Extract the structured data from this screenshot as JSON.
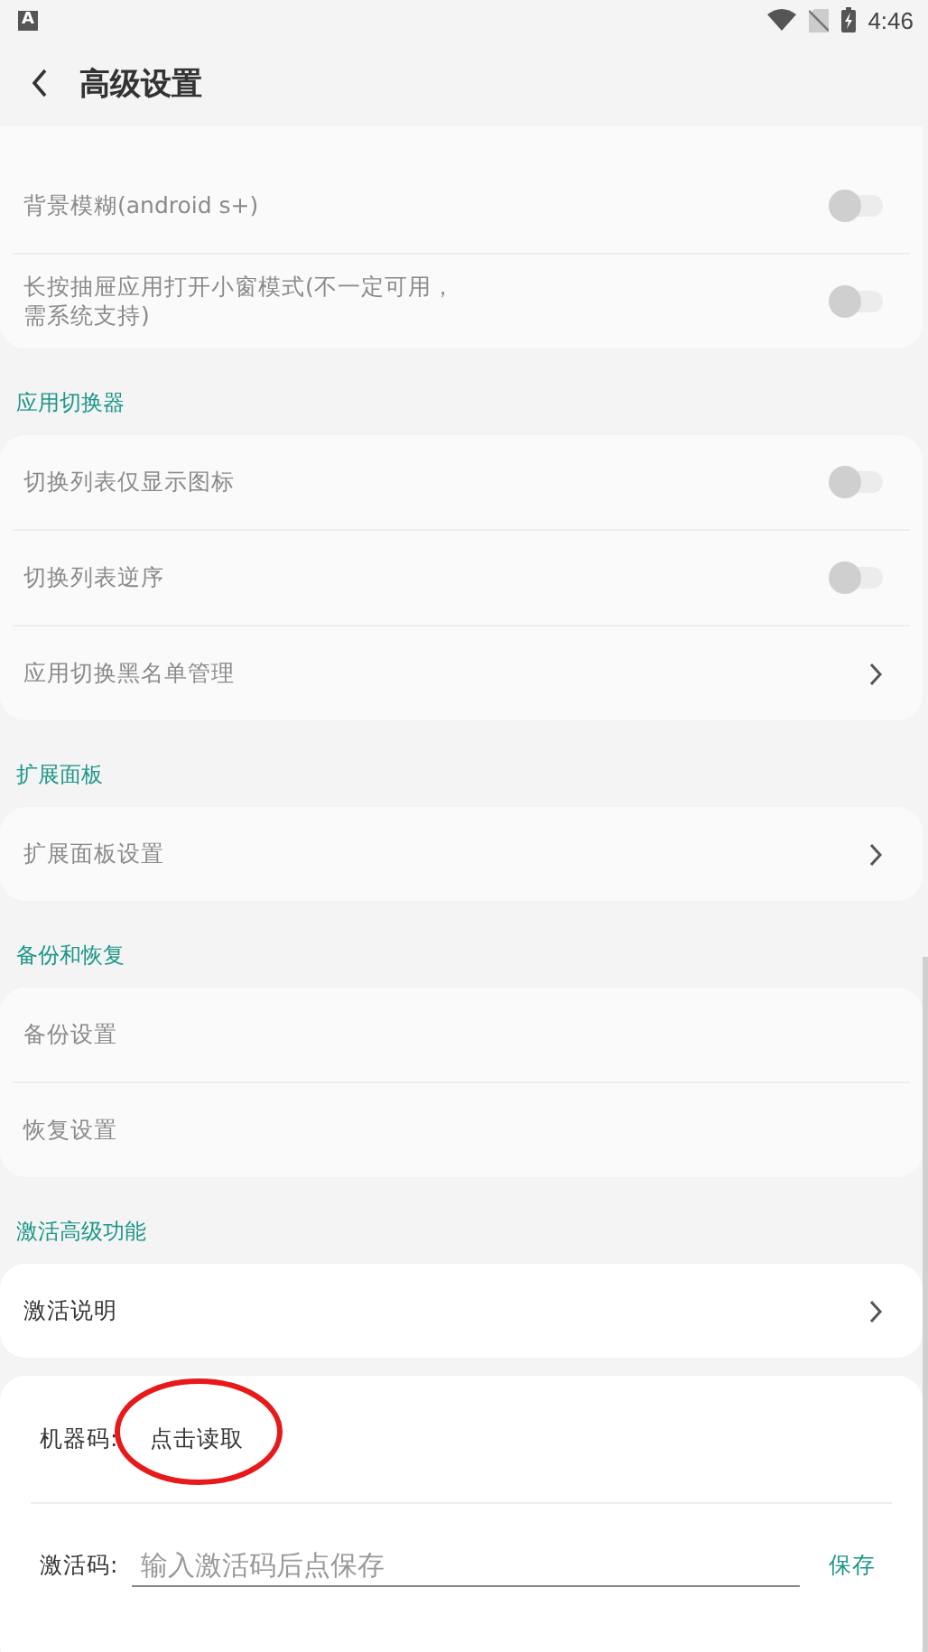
{
  "status_bar": {
    "notification_icon": "A",
    "time": "4:46"
  },
  "header": {
    "title": "高级设置"
  },
  "sections": [
    {
      "items": [
        {
          "kind": "toggle",
          "label": "背景模糊(android s+)",
          "on": false,
          "disabled": true
        },
        {
          "kind": "toggle",
          "label": "长按抽屉应用打开小窗模式(不一定可用，需系统支持)",
          "on": false,
          "disabled": true
        }
      ]
    },
    {
      "title": "应用切换器",
      "items": [
        {
          "kind": "toggle",
          "label": "切换列表仅显示图标",
          "on": false,
          "disabled": true
        },
        {
          "kind": "toggle",
          "label": "切换列表逆序",
          "on": false,
          "disabled": true
        },
        {
          "kind": "link",
          "label": "应用切换黑名单管理",
          "disabled": true
        }
      ]
    },
    {
      "title": "扩展面板",
      "items": [
        {
          "kind": "link",
          "label": "扩展面板设置",
          "disabled": true
        }
      ]
    },
    {
      "title": "备份和恢复",
      "items": [
        {
          "kind": "plain",
          "label": "备份设置",
          "disabled": true
        },
        {
          "kind": "plain",
          "label": "恢复设置",
          "disabled": true
        }
      ]
    },
    {
      "title": "激活高级功能",
      "items": [
        {
          "kind": "link",
          "label": "激活说明",
          "disabled": false
        }
      ]
    }
  ],
  "activation": {
    "machine_code_label": "机器码:",
    "machine_code_value": "点击读取",
    "code_label": "激活码:",
    "code_placeholder": "输入激活码后点保存",
    "save": "保存"
  }
}
